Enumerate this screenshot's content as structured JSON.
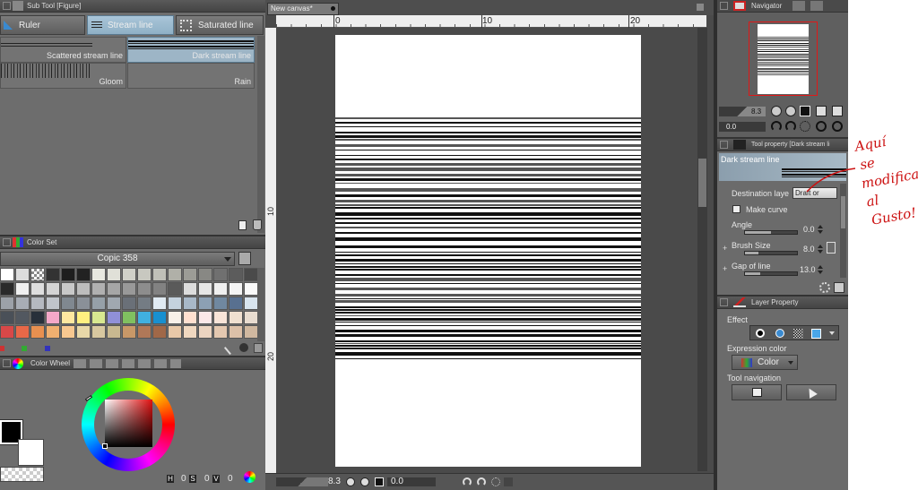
{
  "subtool": {
    "title": "Sub Tool [Figure]",
    "tabs": [
      "Ruler",
      "Stream line",
      "Saturated line"
    ],
    "brushes": [
      "Scattered stream line",
      "Dark stream line",
      "Gloom",
      "Rain"
    ]
  },
  "colorset": {
    "title": "Color Set",
    "set_name": "Copic 358",
    "rows": [
      [
        "#ffffff",
        "#dcdcdc",
        "checker",
        "#333333",
        "#1e1e1e",
        "#222222",
        "#e8e8e0",
        "#e0e0d8",
        "#d0d0c8",
        "#c8c8c0",
        "#c0c0b8",
        "#b0b0a8",
        "#9c9c96",
        "#888884",
        "#707070",
        "#5c5c5c",
        "#4a4a4a"
      ],
      [
        "#2a2a2a",
        "#f0f0f0",
        "#dedede",
        "#d4d4d4",
        "#c8c8c8",
        "#bdbdbd",
        "#b0b0b0",
        "#a6a6a6",
        "#999999",
        "#8d8d8d",
        "#828282",
        "#5a5a5a",
        "#dcdcdc",
        "#e6e6e6",
        "#efefef",
        "#f4f4f4",
        "#fafafa"
      ],
      [
        "#9ca1a8",
        "#a8adb5",
        "#b5b9c0",
        "#c0c4ca",
        "#808890",
        "#8a9098",
        "#96a0a8",
        "#a0a8b0",
        "#6a7078",
        "#747c84",
        "#e0eaf2",
        "#c4d2de",
        "#a8b8c8",
        "#8ca0b4",
        "#7088a0",
        "#587090",
        "#d8e4ee"
      ],
      [
        "#4a5058",
        "#525860",
        "#28303a",
        "#f4a8c8",
        "#ffe8a0",
        "#fff080",
        "#d8e890",
        "#9090d8",
        "#80c060",
        "#40b0e0",
        "#1890d0",
        "#f8f0e8",
        "#ffe0d0",
        "#fce8e8",
        "#f8e4d8",
        "#f0e0d0",
        "#e8dcd0"
      ],
      [
        "#d84848",
        "#e86848",
        "#e89050",
        "#f0b070",
        "#f8c890",
        "#e8d8a8",
        "#d8c8a0",
        "#c8b890",
        "#c89868",
        "#b07858",
        "#a06848",
        "#e8c8a8",
        "#f0d8c0",
        "#ecd4c0",
        "#e4c8b0",
        "#dcc0a8",
        "#d0b8a0"
      ]
    ]
  },
  "colorwheel": {
    "title": "Color Wheel",
    "readouts": {
      "h": "0",
      "s": "0",
      "v": "0"
    },
    "main_color": "#000000",
    "sub_color": "#ffffff"
  },
  "canvas": {
    "tab_title": "New canvas*",
    "ruler_top": [
      "0",
      "10",
      "20"
    ],
    "ruler_left": [
      "10",
      "20"
    ],
    "zoom": "8.3",
    "angle": "0.0"
  },
  "navigator": {
    "title": "Navigator",
    "zoom": "8.3",
    "angle": "0.0"
  },
  "toolprop": {
    "title": "Tool property [Dark stream li",
    "preview_label": "Dark stream line",
    "destination_label": "Destination laye",
    "destination_value": "Draft or",
    "make_curve": "Make curve",
    "angle_label": "Angle",
    "angle_value": "0.0",
    "brush_size_label": "Brush Size",
    "brush_size_value": "8.0",
    "gap_label": "Gap of line",
    "gap_value": "13.0",
    "angle_level": 0.5,
    "brush_size_level": 0.25,
    "gap_level": 0.3
  },
  "layerprop": {
    "title": "Layer Property",
    "effect_label": "Effect",
    "expression_label": "Expression color",
    "expression_value": "Color",
    "toolnav_label": "Tool navigation"
  },
  "annotation": {
    "lines": [
      "Aquí",
      "se",
      "modifica",
      "al",
      "Gusto!"
    ],
    "color": "#cc1111"
  }
}
